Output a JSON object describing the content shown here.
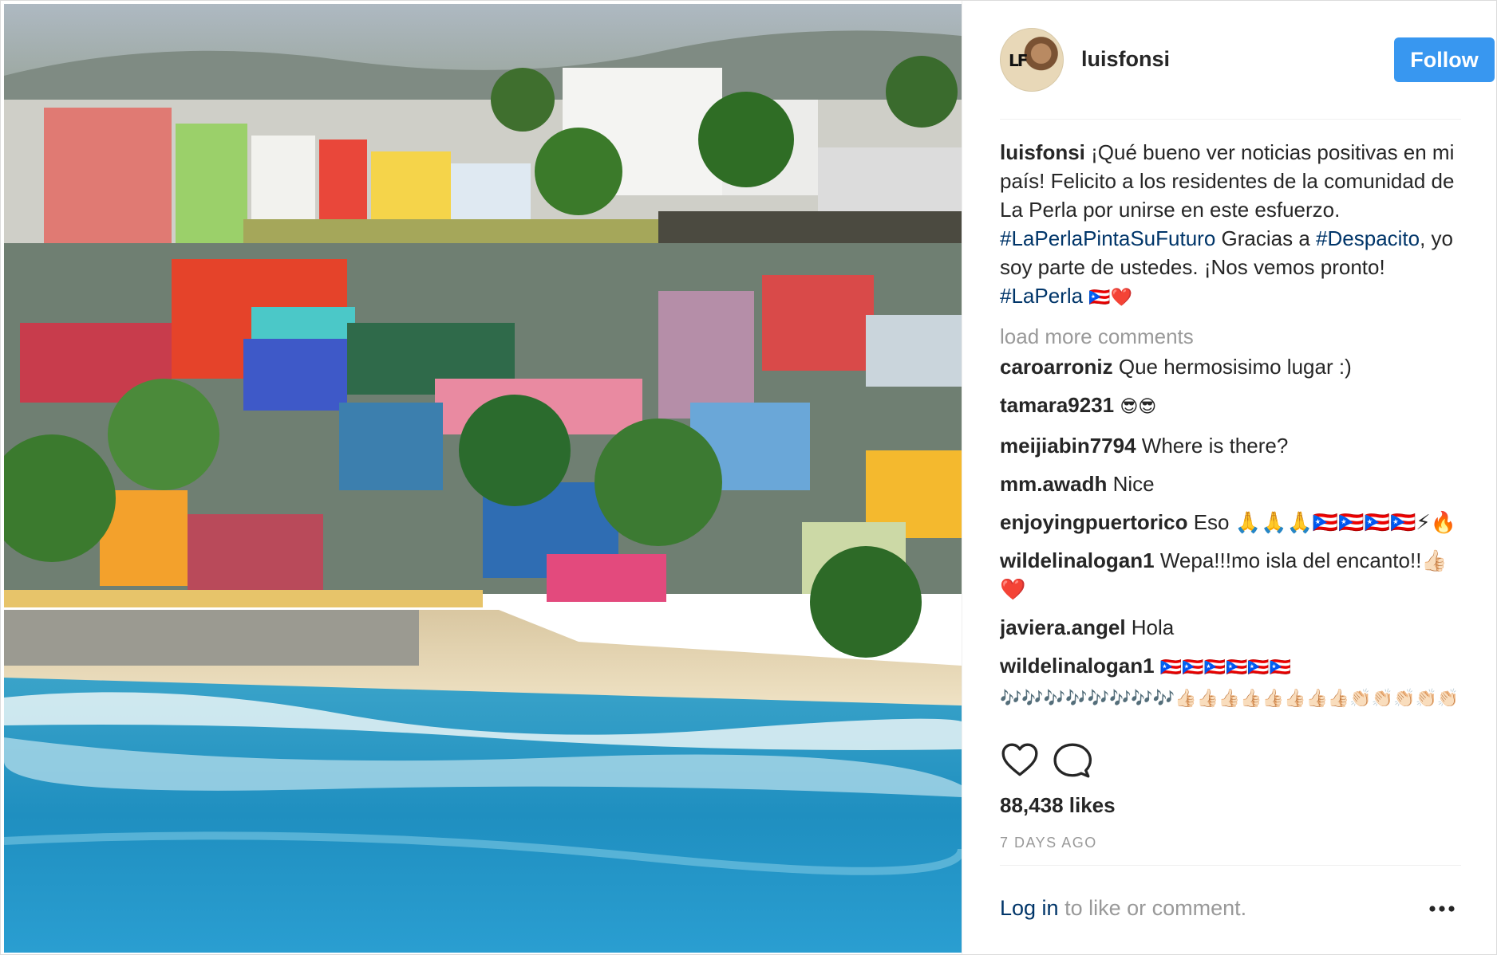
{
  "post": {
    "username": "luisfonsi",
    "follow_label": "Follow",
    "caption": {
      "username": "luisfonsi",
      "text_1": "¡Qué bueno ver noticias positivas en mi país! Felicito a los residentes de la comunidad de La Perla por unirse en este esfuerzo.",
      "hashtag_1": "#LaPerlaPintaSuFuturo",
      "text_2": "Gracias a",
      "hashtag_2": "#Despacito",
      "text_3": ", yo soy parte de ustedes. ¡Nos vemos pronto!",
      "hashtag_3": "#LaPerla",
      "emoji": "🇵🇷❤️"
    },
    "load_more_label": "load more comments",
    "comments": [
      {
        "user": "caroarroniz",
        "text": "Que hermosisimo lugar :)"
      },
      {
        "user": "tamara9231",
        "text": "😎😎"
      },
      {
        "user": "meijiabin7794",
        "text": "Where is there?"
      },
      {
        "user": "mm.awadh",
        "text": "Nice"
      },
      {
        "user": "enjoyingpuertorico",
        "text": "Eso 🙏🙏🙏🇵🇷🇵🇷🇵🇷🇵🇷⚡🔥"
      },
      {
        "user": "wildelinalogan1",
        "text": "Wepa!!!mo isla del encanto!!👍🏻❤️"
      },
      {
        "user": "javiera.angel",
        "text": "Hola"
      },
      {
        "user": "wildelinalogan1",
        "text": "🇵🇷🇵🇷🇵🇷🇵🇷🇵🇷🇵🇷 🎶🎶🎶🎶🎶🎶🎶🎶👍🏻👍🏻👍🏻👍🏻👍🏻👍🏻👍🏻👍🏻👏🏻👏🏻👏🏻👏🏻👏🏻"
      }
    ],
    "actions": {
      "like_icon": "heart-icon",
      "comment_icon": "comment-bubble-icon"
    },
    "likes_label": "88,438 likes",
    "time_label": "7 DAYS AGO",
    "footer": {
      "login_link": "Log in",
      "login_suffix": "to like or comment.",
      "more_icon": "ellipsis-icon"
    }
  }
}
